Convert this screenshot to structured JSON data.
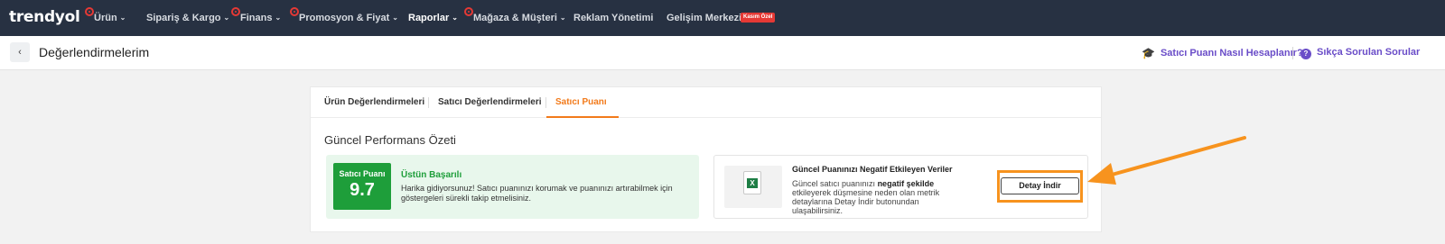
{
  "brand": {
    "logo": "trendyol"
  },
  "topnav": {
    "items": [
      {
        "label": "Ürün",
        "has_dot": true
      },
      {
        "label": "Sipariş & Kargo",
        "has_dot": false
      },
      {
        "label": "Finans",
        "has_dot": true
      },
      {
        "label": "Promosyon & Fiyat",
        "has_dot": true
      },
      {
        "label": "Raporlar",
        "has_dot": false,
        "active": true
      },
      {
        "label": "Mağaza & Müşteri",
        "has_dot": true
      },
      {
        "label": "Reklam Yönetimi",
        "has_dot": false
      },
      {
        "label": "Gelişim Merkezi",
        "has_dot": false
      }
    ],
    "badge": "Kasım Özel",
    "chevron": "⌄"
  },
  "subheader": {
    "back_icon": "chevron-left-icon",
    "title": "Değerlendirmelerim",
    "links": {
      "score_help": "Satıcı Puanı Nasıl Hesaplanır?",
      "faq": "Sıkça Sorulan Sorular"
    }
  },
  "tabs": {
    "product_reviews": "Ürün Değerlendirmeleri",
    "seller_reviews": "Satıcı Değerlendirmeleri",
    "seller_score": "Satıcı Puanı",
    "active": "Satıcı Puanı"
  },
  "summary": {
    "title": "Güncel Performans Özeti",
    "score_label": "Satıcı Puanı",
    "score_value": "9.7",
    "status_title": "Üstün Başarılı",
    "status_text": "Harika gidiyorsunuz! Satıcı puanınızı korumak ve puanınızı artırabilmek için göstergeleri sürekli takip etmelisiniz."
  },
  "negative": {
    "title": "Güncel Puanınızı Negatif Etkileyen Veriler",
    "text_pre": "Güncel satıcı puanınızı ",
    "text_bold": "negatif şekilde",
    "text_post": " etkileyerek düşmesine neden olan metrik detaylarına Detay İndir butonundan ulaşabilirsiniz.",
    "button": "Detay İndir",
    "file_icon": "excel-file-icon"
  },
  "colors": {
    "nav_bg": "#273142",
    "accent": "#f27a1a",
    "success": "#1e9e3a",
    "link": "#6a4dc8",
    "highlight": "#f7931e"
  }
}
